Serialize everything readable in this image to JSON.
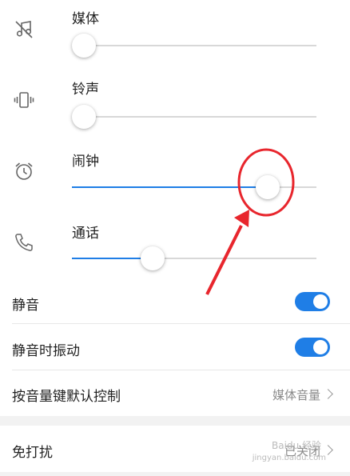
{
  "volume": {
    "items": [
      {
        "label": "媒体",
        "icon": "music-muted-icon",
        "level": 0.0
      },
      {
        "label": "铃声",
        "icon": "vibrate-icon",
        "level": 0.0
      },
      {
        "label": "闹钟",
        "icon": "alarm-clock-icon",
        "level": 0.8
      },
      {
        "label": "通话",
        "icon": "phone-icon",
        "level": 0.33
      }
    ]
  },
  "settings": {
    "silent": {
      "label": "静音",
      "on": true
    },
    "vibrate_on_silent": {
      "label": "静音时振动",
      "on": true
    },
    "volume_key_default": {
      "label": "按音量键默认控制",
      "value": "媒体音量"
    },
    "do_not_disturb": {
      "label": "免打扰",
      "value": "已关闭"
    }
  },
  "watermark": {
    "line1": "Baidu 经验",
    "line2": "jingyan.baidu.com"
  },
  "colors": {
    "accent": "#1f7ee6",
    "annotation": "#e8262d"
  }
}
